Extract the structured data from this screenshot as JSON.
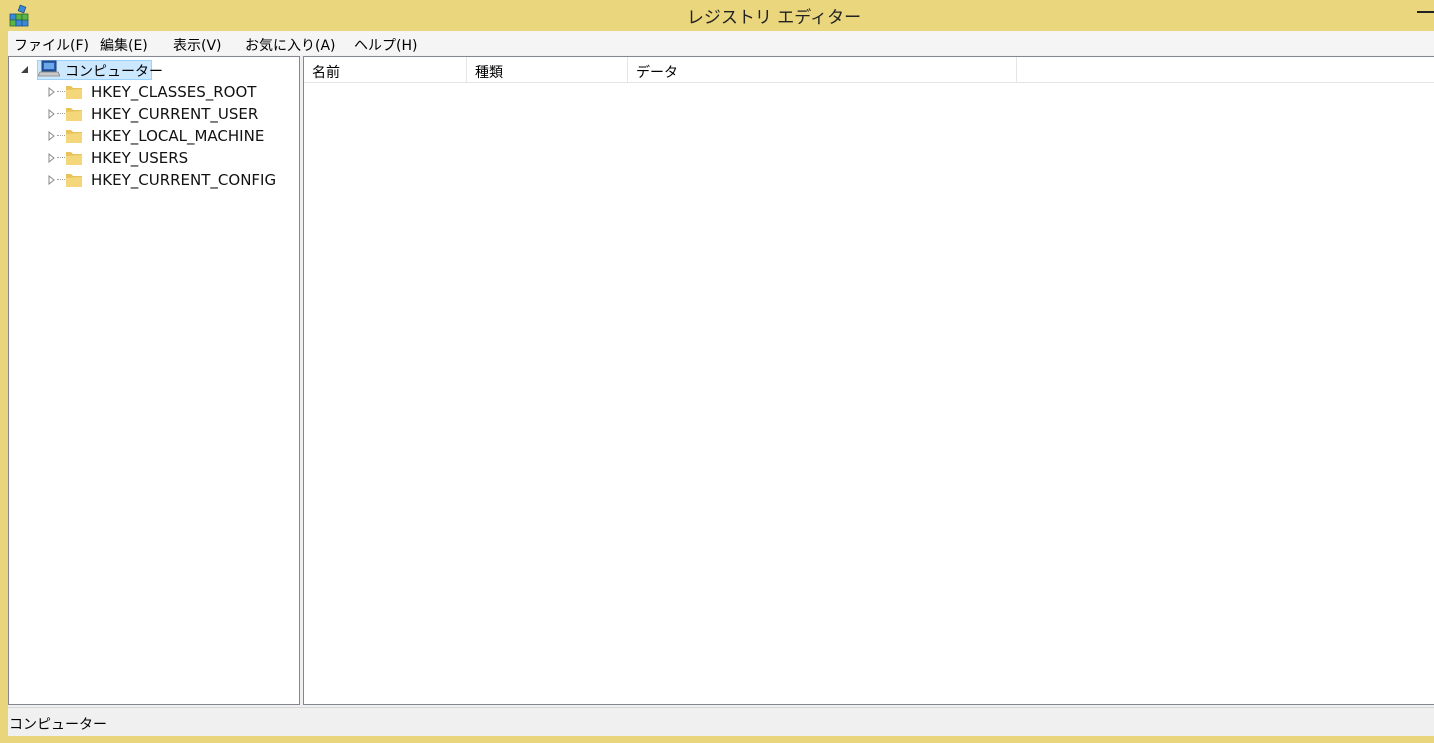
{
  "window": {
    "title": "レジストリ エディター",
    "app_icon": "registry-editor-icon",
    "minimize_icon": "minimize-icon",
    "frame_color": "#EAD67D"
  },
  "menu": {
    "items": [
      {
        "label": "ファイル(F)"
      },
      {
        "label": "編集(E)"
      },
      {
        "label": "表示(V)"
      },
      {
        "label": "お気に入り(A)"
      },
      {
        "label": "ヘルプ(H)"
      }
    ]
  },
  "tree": {
    "root": {
      "label": "コンピューター",
      "icon": "computer-icon",
      "expanded": true,
      "selected": true
    },
    "keys": [
      {
        "label": "HKEY_CLASSES_ROOT",
        "icon": "folder-icon"
      },
      {
        "label": "HKEY_CURRENT_USER",
        "icon": "folder-icon"
      },
      {
        "label": "HKEY_LOCAL_MACHINE",
        "icon": "folder-icon"
      },
      {
        "label": "HKEY_USERS",
        "icon": "folder-icon"
      },
      {
        "label": "HKEY_CURRENT_CONFIG",
        "icon": "folder-icon"
      }
    ]
  },
  "list": {
    "columns": [
      {
        "label": "名前"
      },
      {
        "label": "種類"
      },
      {
        "label": "データ"
      }
    ]
  },
  "status": {
    "path": "コンピューター"
  },
  "colors": {
    "selection_bg": "#CCE8FF",
    "selection_border": "#99D1FF"
  }
}
